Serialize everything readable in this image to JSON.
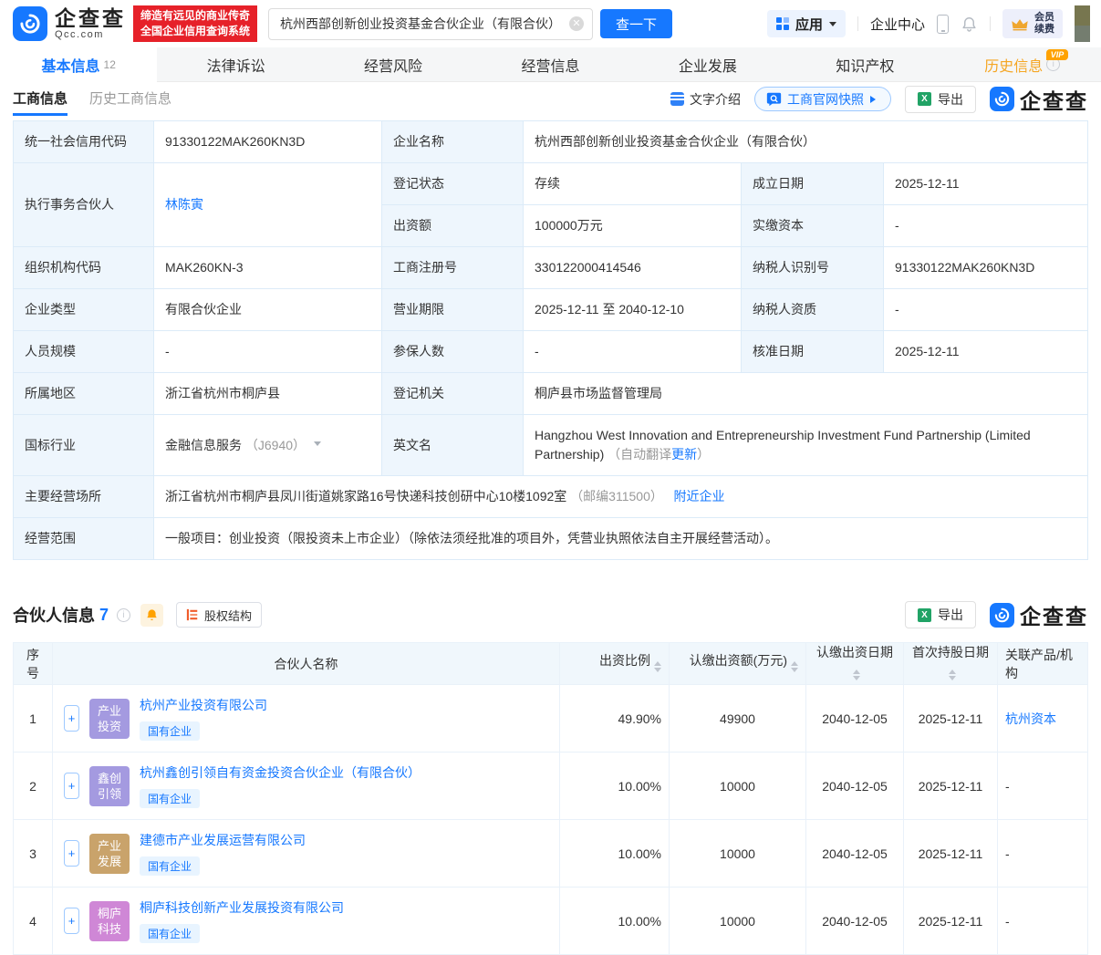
{
  "colors": {
    "accent": "#1678ff",
    "slogan_red": "#e62129",
    "history_orange": "#f5a623"
  },
  "header": {
    "logo": {
      "brand": "企查查",
      "domain": "Qcc.com"
    },
    "slogan_line1": "缔造有远见的商业传奇",
    "slogan_line2": "全国企业信用查询系统",
    "search": {
      "value": "杭州西部创新创业投资基金合伙企业（有限合伙）",
      "button": "查一下"
    },
    "nav": {
      "apps": "应用",
      "enterprise_center": "企业中心",
      "vip_line1": "会员",
      "vip_line2": "续费"
    }
  },
  "tabs": [
    {
      "label": "基本信息",
      "count": "12"
    },
    {
      "label": "法律诉讼"
    },
    {
      "label": "经营风险"
    },
    {
      "label": "经营信息"
    },
    {
      "label": "企业发展"
    },
    {
      "label": "知识产权"
    },
    {
      "label": "历史信息",
      "vip": "VIP"
    }
  ],
  "subtabs": {
    "active": "工商信息",
    "inactive": "历史工商信息"
  },
  "toolbar": {
    "text_intro": "文字介绍",
    "snapshot": "工商官网快照",
    "export": "导出",
    "watermark": "企查查"
  },
  "info": {
    "credit_code_label": "统一社会信用代码",
    "credit_code": "91330122MAK260KN3D",
    "company_name_label": "企业名称",
    "company_name": "杭州西部创新创业投资基金合伙企业（有限合伙）",
    "managing_partner_label": "执行事务合伙人",
    "managing_partner": "林陈寅",
    "reg_status_label": "登记状态",
    "reg_status": "存续",
    "est_date_label": "成立日期",
    "est_date": "2025-12-11",
    "capital_label": "出资额",
    "capital": "100000万元",
    "paid_capital_label": "实缴资本",
    "paid_capital": "-",
    "org_code_label": "组织机构代码",
    "org_code": "MAK260KN-3",
    "reg_no_label": "工商注册号",
    "reg_no": "330122000414546",
    "taxpayer_id_label": "纳税人识别号",
    "taxpayer_id": "91330122MAK260KN3D",
    "company_type_label": "企业类型",
    "company_type": "有限合伙企业",
    "business_term_label": "营业期限",
    "business_term": "2025-12-11 至 2040-12-10",
    "taxpayer_qual_label": "纳税人资质",
    "taxpayer_qual": "-",
    "staff_size_label": "人员规模",
    "staff_size": "-",
    "insured_label": "参保人数",
    "insured": "-",
    "approval_date_label": "核准日期",
    "approval_date": "2025-12-11",
    "region_label": "所属地区",
    "region": "浙江省杭州市桐庐县",
    "reg_authority_label": "登记机关",
    "reg_authority": "桐庐县市场监督管理局",
    "industry_label": "国标行业",
    "industry_name": "金融信息服务",
    "industry_code": "（J6940）",
    "en_name_label": "英文名",
    "en_name": "Hangzhou West Innovation and Entrepreneurship Investment Fund Partnership (Limited Partnership)",
    "en_note_open": "（自动翻译",
    "en_note_link": "更新",
    "en_note_close": "）",
    "address_label": "主要经营场所",
    "address": "浙江省杭州市桐庐县凤川街道姚家路16号快递科技创研中心10楼1092室",
    "address_postal": "（邮编311500）",
    "nearby": "附近企业",
    "scope_label": "经营范围",
    "scope": "一般项目：创业投资（限投资未上市企业）（除依法须经批准的项目外，凭营业执照依法自主开展经营活动）。"
  },
  "partners": {
    "title": "合伙人信息",
    "count": "7",
    "equity_btn": "股权结构",
    "export": "导出",
    "watermark": "企查查",
    "columns": [
      "序号",
      "合伙人名称",
      "出资比例",
      "认缴出资额(万元)",
      "认缴出资日期",
      "首次持股日期",
      "关联产品/机构"
    ],
    "rows": [
      {
        "no": "1",
        "avatar_line1": "产业",
        "avatar_line2": "投资",
        "avatar_color": "#a49ae0",
        "name": "杭州产业投资有限公司",
        "tag": "国有企业",
        "ratio": "49.90%",
        "amount": "49900",
        "pay_date": "2040-12-05",
        "first_hold_date": "2025-12-11",
        "related": "杭州资本"
      },
      {
        "no": "2",
        "avatar_line1": "鑫创",
        "avatar_line2": "引领",
        "avatar_color": "#a49ae0",
        "name": "杭州鑫创引领自有资金投资合伙企业（有限合伙）",
        "tag": "国有企业",
        "ratio": "10.00%",
        "amount": "10000",
        "pay_date": "2040-12-05",
        "first_hold_date": "2025-12-11",
        "related": "-"
      },
      {
        "no": "3",
        "avatar_line1": "产业",
        "avatar_line2": "发展",
        "avatar_color": "#c9a36b",
        "name": "建德市产业发展运营有限公司",
        "tag": "国有企业",
        "ratio": "10.00%",
        "amount": "10000",
        "pay_date": "2040-12-05",
        "first_hold_date": "2025-12-11",
        "related": "-"
      },
      {
        "no": "4",
        "avatar_line1": "桐庐",
        "avatar_line2": "科技",
        "avatar_color": "#cf87d6",
        "name": "桐庐科技创新产业发展投资有限公司",
        "tag": "国有企业",
        "ratio": "10.00%",
        "amount": "10000",
        "pay_date": "2040-12-05",
        "first_hold_date": "2025-12-11",
        "related": "-"
      }
    ]
  }
}
